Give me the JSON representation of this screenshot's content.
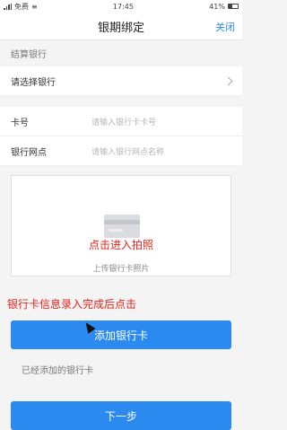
{
  "status_bar": {
    "left": "免费",
    "time": "17:45",
    "battery": "41%"
  },
  "navbar": {
    "title": "银期绑定",
    "close": "关闭"
  },
  "settlement": {
    "section_label": "结算银行",
    "select_bank": "请选择银行"
  },
  "form": {
    "card_no_label": "卡号",
    "card_no_placeholder": "请输入银行卡卡号",
    "branch_label": "银行网点",
    "branch_placeholder": "请输入银行网点名称"
  },
  "upload": {
    "hint": "上传银行卡照片",
    "annotation": "点击进入拍照"
  },
  "annotation_add": "银行卡信息录入完成后点击",
  "buttons": {
    "add_bank_card": "添加银行卡",
    "next": "下一步"
  },
  "added_cards_label": "已经添加的银行卡",
  "colors": {
    "accent": "#2b8af0",
    "annotation": "#e2231a"
  },
  "icons": [
    "signal-icon",
    "wifi-icon",
    "battery-icon",
    "chevron-right-icon",
    "bank-card-icon",
    "cursor-icon"
  ]
}
